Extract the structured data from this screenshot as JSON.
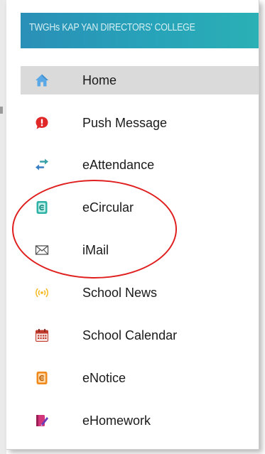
{
  "header": {
    "title": "TWGHs KAP YAN DIRECTORS' COLLEGE"
  },
  "menu": {
    "items": [
      {
        "label": "Home",
        "icon": "home-icon",
        "selected": true
      },
      {
        "label": "Push Message",
        "icon": "push-message-icon"
      },
      {
        "label": "eAttendance",
        "icon": "swap-arrows-icon"
      },
      {
        "label": "eCircular",
        "icon": "circular-document-icon"
      },
      {
        "label": "iMail",
        "icon": "envelope-icon"
      },
      {
        "label": "School News",
        "icon": "broadcast-icon"
      },
      {
        "label": "School Calendar",
        "icon": "calendar-icon"
      },
      {
        "label": "eNotice",
        "icon": "notice-icon"
      },
      {
        "label": "eHomework",
        "icon": "homework-icon"
      }
    ]
  },
  "colors": {
    "header_bg": "#2a98b8",
    "selected_bg": "#dadada",
    "annotation": "#e01f1f",
    "home_icon": "#5aa8e6",
    "push_icon": "#e02828",
    "attendance_icon": "#3aa0a8",
    "circular_icon": "#2fb3a6",
    "news_icon": "#f4b820",
    "calendar_icon": "#c0392b",
    "notice_icon": "#f08a1c",
    "homework_icon": "#d2357a"
  }
}
